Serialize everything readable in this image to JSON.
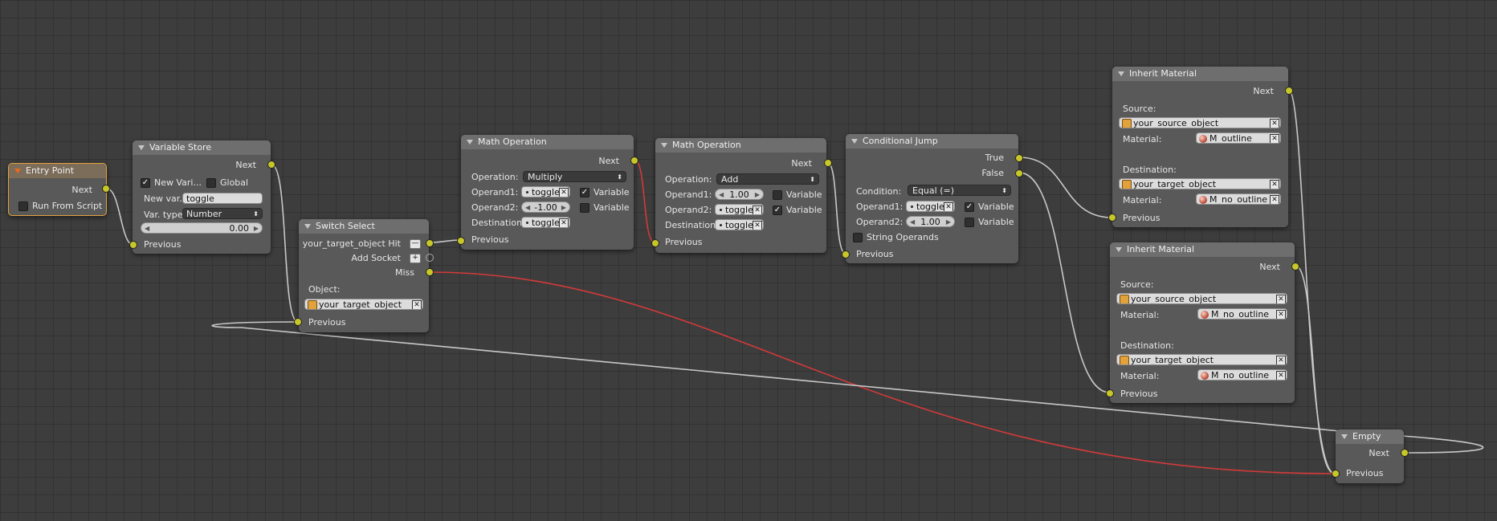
{
  "entry_point": {
    "title": "Entry Point",
    "next": "Next",
    "run_from_script": "Run From Script"
  },
  "variable_store": {
    "title": "Variable Store",
    "next": "Next",
    "new_var_check": "New Vari...",
    "global": "Global",
    "new_var_label": "New var.",
    "new_var_value": "toggle",
    "var_type_label": "Var. type",
    "var_type_value": "Number",
    "number_value": "0.00",
    "previous": "Previous"
  },
  "switch_select": {
    "title": "Switch Select",
    "hit": "your_target_object Hit",
    "hit_btn": "—",
    "add_socket": "Add Socket",
    "add_btn": "+",
    "miss": "Miss",
    "object_label": "Object:",
    "object_value": "your_target_object",
    "previous": "Previous"
  },
  "math_op_1": {
    "title": "Math Operation",
    "next": "Next",
    "operation_label": "Operation:",
    "operation_value": "Multiply",
    "operand1_label": "Operand1:",
    "operand1_value": "toggle",
    "operand1_var": "Variable",
    "operand2_label": "Operand2:",
    "operand2_value": "-1.00",
    "operand2_var": "Variable",
    "destination_label": "Destination:",
    "destination_value": "toggle",
    "previous": "Previous"
  },
  "math_op_2": {
    "title": "Math Operation",
    "next": "Next",
    "operation_label": "Operation:",
    "operation_value": "Add",
    "operand1_label": "Operand1:",
    "operand1_value": "1.00",
    "operand1_var": "Variable",
    "operand2_label": "Operand2:",
    "operand2_value": "toggle",
    "operand2_var": "Variable",
    "destination_label": "Destination:",
    "destination_value": "toggle",
    "previous": "Previous"
  },
  "conditional_jump": {
    "title": "Conditional Jump",
    "true": "True",
    "false": "False",
    "condition_label": "Condition:",
    "condition_value": "Equal (=)",
    "operand1_label": "Operand1:",
    "operand1_value": "toggle",
    "operand1_var": "Variable",
    "operand2_label": "Operand2:",
    "operand2_value": "1.00",
    "operand2_var": "Variable",
    "string_operands": "String Operands",
    "previous": "Previous"
  },
  "inherit_material_1": {
    "title": "Inherit Material",
    "next": "Next",
    "source_label": "Source:",
    "source_value": "your_source_object",
    "material_label": "Material:",
    "source_material": "M_outline",
    "destination_label": "Destination:",
    "destination_value": "your_target_object",
    "destination_material": "M_no_outline",
    "previous": "Previous"
  },
  "inherit_material_2": {
    "title": "Inherit Material",
    "next": "Next",
    "source_label": "Source:",
    "source_value": "your_source_object",
    "material_label": "Material:",
    "source_material": "M_no_outline",
    "destination_label": "Destination:",
    "destination_value": "your_target_object",
    "destination_material": "M_no_outline",
    "previous": "Previous"
  },
  "empty_node": {
    "title": "Empty",
    "next": "Next",
    "previous": "Previous"
  },
  "colors": {
    "socket": "#c7c729",
    "wire": "#c8c8c8",
    "wire_active": "#d23a3a",
    "selected_border": "#e8a23b"
  }
}
